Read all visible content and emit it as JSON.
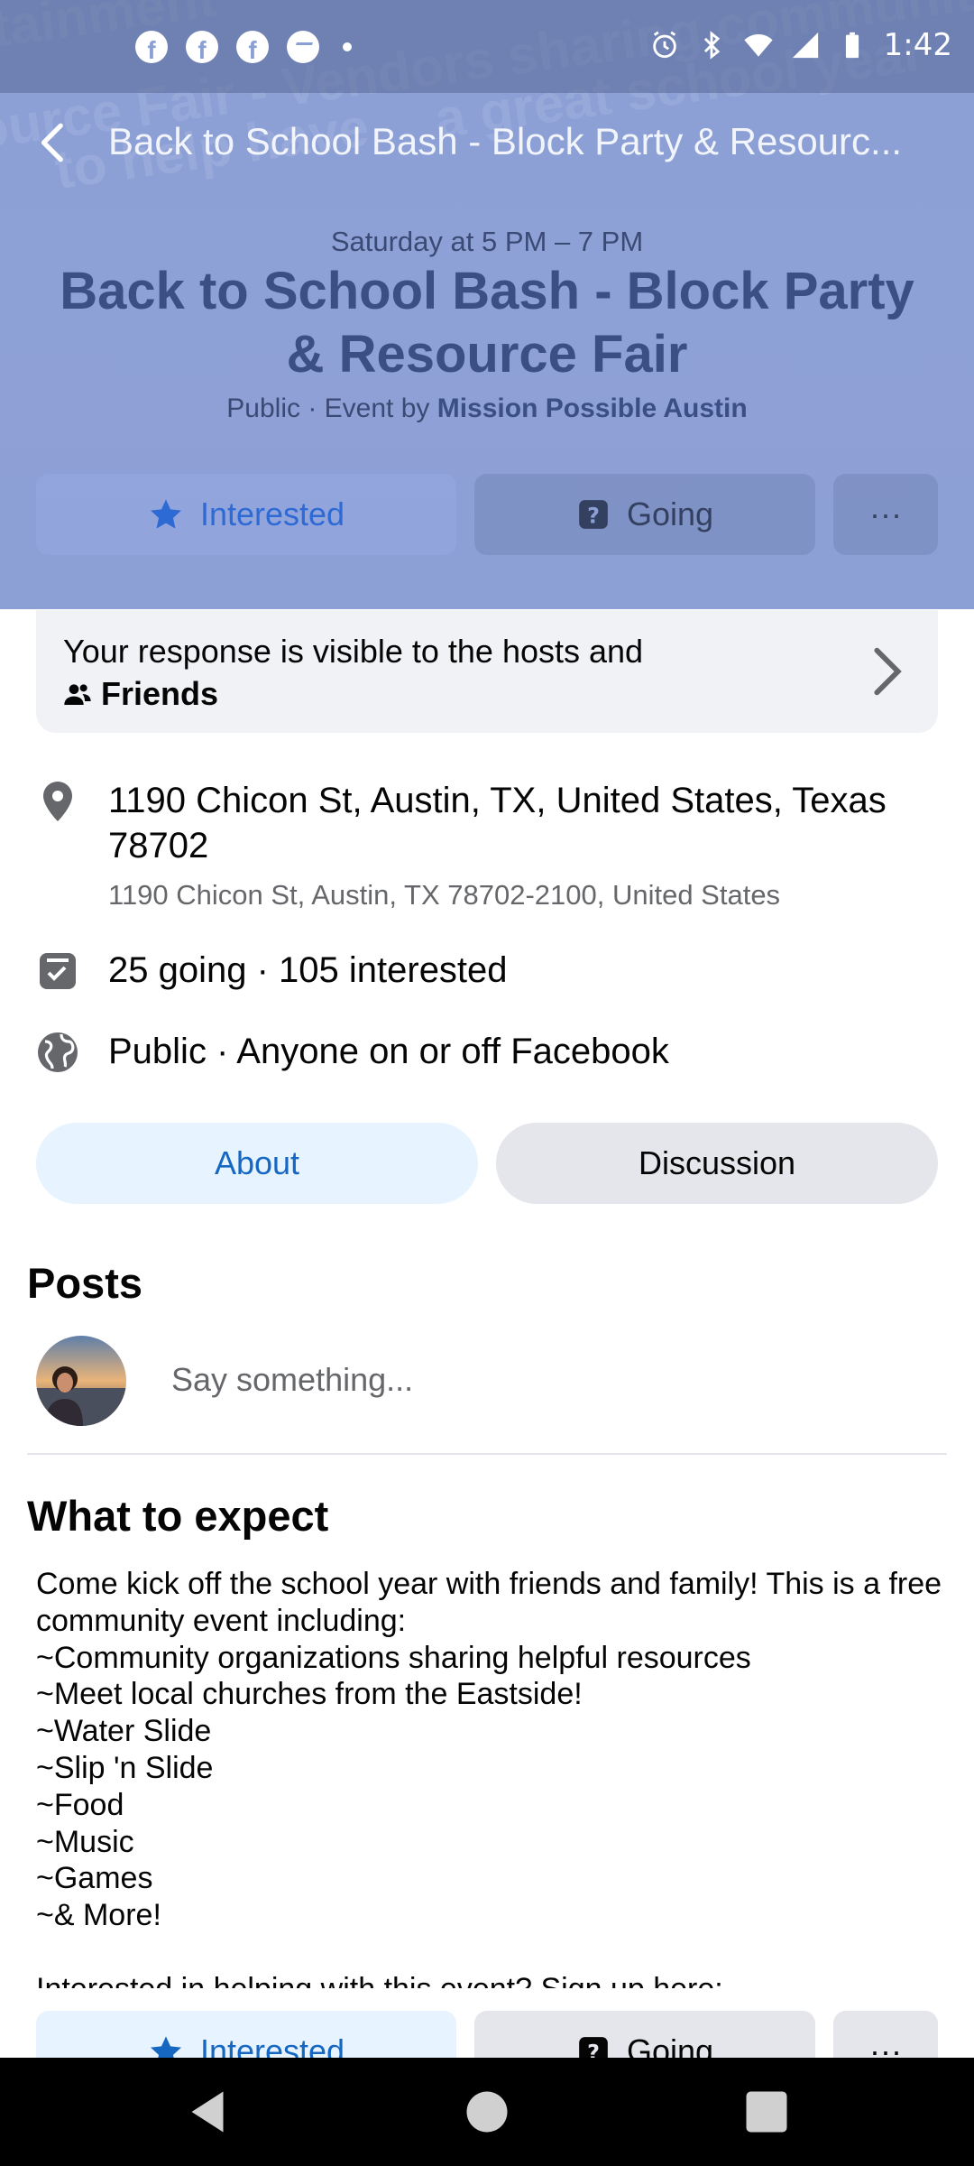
{
  "status_bar": {
    "time": "1:42",
    "notification_icons": [
      "facebook-icon",
      "facebook-icon",
      "facebook-icon",
      "messenger-icon",
      "dot-icon"
    ],
    "system_icons": [
      "alarm-icon",
      "bluetooth-icon",
      "wifi-icon",
      "signal-icon",
      "battery-icon"
    ]
  },
  "background_text": [
    "tainment",
    "sharing community",
    "ource Fair - Vendors",
    "a great school year",
    "to help have"
  ],
  "topbar": {
    "title": "Back to School Bash - Block Party & Resourc..."
  },
  "event": {
    "date": "Saturday at 5 PM – 7 PM",
    "title": "Back to School Bash - Block Party & Resource Fair",
    "privacy": "Public · Event by ",
    "host": "Mission Possible Austin"
  },
  "actions": {
    "interested": "Interested",
    "going": "Going",
    "more": "···"
  },
  "response": {
    "text": "Your response is visible to the hosts and",
    "audience": "Friends"
  },
  "location": {
    "main": "1190 Chicon St, Austin, TX, United States, Texas 78702",
    "sub": "1190 Chicon St, Austin, TX 78702-2100, United States"
  },
  "attendance": "25 going · 105 interested",
  "visibility": "Public · Anyone on or off Facebook",
  "tabs": {
    "about": "About",
    "discussion": "Discussion"
  },
  "posts": {
    "heading": "Posts",
    "composer_placeholder": "Say something..."
  },
  "expect": {
    "heading": "What to expect",
    "intro": "Come kick off the school year with friends and family! This is a free community event including:",
    "items": [
      "~Community organizations sharing helpful resources",
      "~Meet local churches from the Eastside!",
      "~Water Slide",
      "~Slip 'n Slide",
      "~Food",
      "~Music",
      "~Games",
      "~& More!"
    ],
    "help_line": "Interested in helping with this event? Sign up here:"
  },
  "colors": {
    "header_bg": "#8a9fd4",
    "accent_blue": "#1667c2",
    "light_gray": "#e4e6eb"
  }
}
